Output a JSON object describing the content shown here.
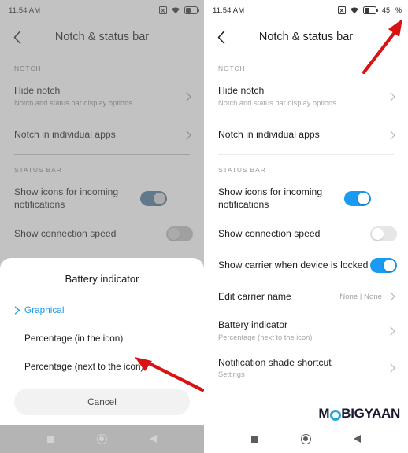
{
  "colors": {
    "accent_blue": "#1a9af0",
    "link_blue": "#1b9ae8",
    "arrow_red": "#d81313",
    "section_header": "#9a9a9a",
    "subtitle": "#a6a6a6",
    "watermark_dark": "#1a1a2e",
    "watermark_ring": "#1ea5e8"
  },
  "left_phone": {
    "status_bar": {
      "clock": "11:54 AM",
      "icons": [
        "no-sim-icon",
        "wifi-icon",
        "battery-icon"
      ],
      "battery_percent_visible": false
    },
    "app_bar": {
      "back_icon": "chevron-left-icon",
      "title": "Notch & status bar"
    },
    "sections": [
      {
        "header": "NOTCH",
        "rows": [
          {
            "title": "Hide notch",
            "subtitle": "Notch and status bar display options",
            "accessory": "chevron"
          },
          {
            "title": "Notch in individual apps",
            "subtitle": "",
            "accessory": "chevron"
          }
        ]
      },
      {
        "header": "STATUS BAR",
        "rows": [
          {
            "title": "Show icons for incoming notifications",
            "subtitle": "",
            "accessory": "toggle",
            "toggle": "on"
          },
          {
            "title": "Show connection speed",
            "subtitle": "",
            "accessory": "toggle",
            "toggle": "off"
          }
        ]
      }
    ],
    "dialog": {
      "title": "Battery indicator",
      "options": [
        {
          "label": "Graphical",
          "selected": true
        },
        {
          "label": "Percentage (in the icon)",
          "selected": false
        },
        {
          "label": "Percentage (next to the icon)",
          "selected": false
        }
      ],
      "cancel_label": "Cancel"
    },
    "nav_bar": [
      "recents-square-icon",
      "home-circle-icon",
      "back-triangle-icon"
    ],
    "annotation": {
      "arrow": "red-arrow-pointing-up-left",
      "target": "Percentage (next to the icon)"
    }
  },
  "right_phone": {
    "status_bar": {
      "clock": "11:54 AM",
      "icons": [
        "no-sim-icon",
        "wifi-icon",
        "battery-icon"
      ],
      "battery_percent": "45",
      "battery_percent_symbol": "%"
    },
    "app_bar": {
      "back_icon": "chevron-left-icon",
      "title": "Notch & status bar"
    },
    "sections": [
      {
        "header": "NOTCH",
        "rows": [
          {
            "title": "Hide notch",
            "subtitle": "Notch and status bar display options",
            "accessory": "chevron"
          },
          {
            "title": "Notch in individual apps",
            "subtitle": "",
            "accessory": "chevron"
          }
        ]
      },
      {
        "header": "STATUS BAR",
        "rows": [
          {
            "title": "Show icons for incoming notifications",
            "subtitle": "",
            "accessory": "toggle",
            "toggle": "on"
          },
          {
            "title": "Show connection speed",
            "subtitle": "",
            "accessory": "toggle",
            "toggle": "off"
          },
          {
            "title": "Show carrier when device is locked",
            "subtitle": "",
            "accessory": "toggle",
            "toggle": "on"
          },
          {
            "title": "Edit carrier name",
            "subtitle": "",
            "value": "None | None",
            "accessory": "chevron"
          },
          {
            "title": "Battery indicator",
            "subtitle": "Percentage (next to the icon)",
            "accessory": "chevron"
          },
          {
            "title": "Notification shade shortcut",
            "subtitle": "Settings",
            "accessory": "chevron"
          }
        ]
      }
    ],
    "watermark": {
      "pre": "M",
      "post": "BIGYAAN",
      "full": "MOBIGYAAN"
    },
    "nav_bar": [
      "recents-square-icon",
      "home-circle-icon",
      "back-triangle-icon"
    ],
    "annotation": {
      "arrow": "red-arrow-pointing-up-right",
      "target": "battery percentage 45%"
    }
  }
}
